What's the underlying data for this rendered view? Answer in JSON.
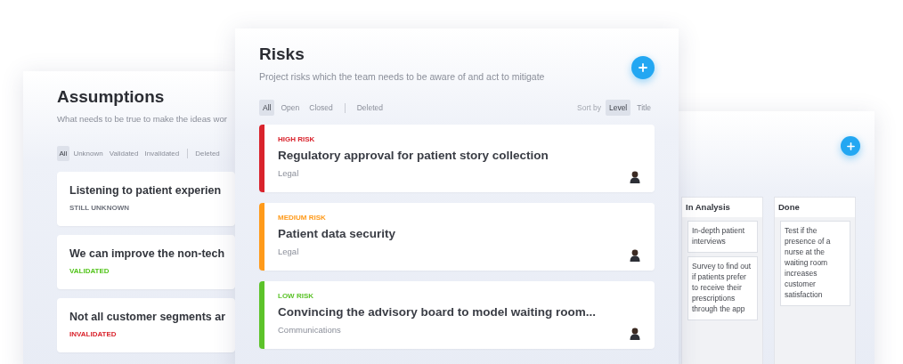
{
  "assumptions": {
    "title": "Assumptions",
    "subtitle": "What needs to be true to make the ideas wor",
    "filters": [
      {
        "label": "All",
        "selected": true
      },
      {
        "label": "Unknown",
        "selected": false
      },
      {
        "label": "Validated",
        "selected": false
      },
      {
        "label": "Invalidated",
        "selected": false
      }
    ],
    "extra_filters": [
      {
        "label": "Deleted",
        "selected": false
      }
    ],
    "cards": [
      {
        "title": "Listening to patient experien",
        "status": "STILL UNKNOWN",
        "kind": "unknown"
      },
      {
        "title": "We can improve the non-tech",
        "status": "VALIDATED",
        "kind": "validated"
      },
      {
        "title": "Not all customer segments ar",
        "status": "INVALIDATED",
        "kind": "invalidated"
      }
    ]
  },
  "risks": {
    "title": "Risks",
    "subtitle": "Project risks which the team needs to be aware of and act to mitigate",
    "filters": [
      {
        "label": "All",
        "selected": true
      },
      {
        "label": "Open",
        "selected": false
      },
      {
        "label": "Closed",
        "selected": false
      }
    ],
    "extra_filters": [
      {
        "label": "Deleted",
        "selected": false
      }
    ],
    "sort": {
      "label": "Sort by",
      "options": [
        {
          "label": "Level",
          "selected": true
        },
        {
          "label": "Title",
          "selected": false
        }
      ]
    },
    "cards": [
      {
        "level": "HIGH RISK",
        "kind": "high",
        "title": "Regulatory approval for patient story collection",
        "category": "Legal"
      },
      {
        "level": "MEDIUM RISK",
        "kind": "medium",
        "title": "Patient data security",
        "category": "Legal"
      },
      {
        "level": "LOW RISK",
        "kind": "low",
        "title": "Convincing the advisory board to model waiting room...",
        "category": "Communications"
      }
    ]
  },
  "board": {
    "columns": [
      {
        "title": "In Analysis",
        "cards": [
          "In-depth patient interviews",
          "Survey to find out if patients prefer to receive their prescriptions through the app"
        ]
      },
      {
        "title": "Done",
        "cards": [
          "Test if the presence of a nurse at the waiting room increases customer satisfaction"
        ]
      }
    ]
  }
}
